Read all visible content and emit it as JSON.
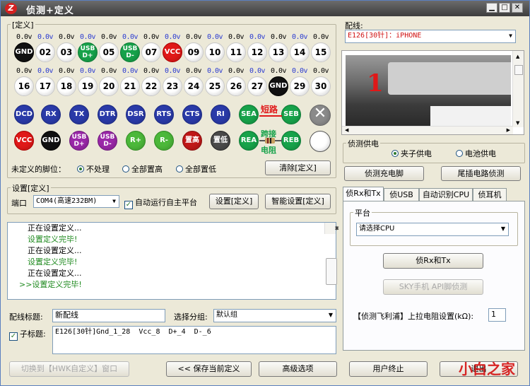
{
  "window": {
    "title": "侦测+定义",
    "app_icon": "Z",
    "controls": [
      "▁",
      "□",
      "✕"
    ]
  },
  "define_group": {
    "title": "[定义]"
  },
  "row1_voltages": [
    "0.0v",
    "0.0v",
    "0.0v",
    "0.0v",
    "0.0v",
    "0.0v",
    "0.0v",
    "0.0v",
    "0.0v",
    "0.0v",
    "0.0v",
    "0.0v",
    "0.0v",
    "0.0v",
    "0.0v",
    "0.0v",
    "0.0v",
    "0.0v",
    "0.0v",
    "0.0v",
    "0.0v",
    "0.0v",
    "0.0v",
    "0.0v",
    "0.0v",
    "0.0v",
    "0.0v",
    "0.0v",
    "0.0v",
    "0.0v"
  ],
  "row1_pins": [
    {
      "label": "GND",
      "style": "black"
    },
    {
      "label": "02",
      "style": "white"
    },
    {
      "label": "03",
      "style": "white"
    },
    {
      "label": "USB D+",
      "style": "green"
    },
    {
      "label": "05",
      "style": "white"
    },
    {
      "label": "USB D-",
      "style": "green"
    },
    {
      "label": "07",
      "style": "white"
    },
    {
      "label": "VCC",
      "style": "red"
    },
    {
      "label": "09",
      "style": "white"
    },
    {
      "label": "10",
      "style": "white"
    },
    {
      "label": "11",
      "style": "white"
    },
    {
      "label": "12",
      "style": "white"
    },
    {
      "label": "13",
      "style": "white"
    },
    {
      "label": "14",
      "style": "white"
    },
    {
      "label": "15",
      "style": "white"
    }
  ],
  "row2_pins": [
    {
      "label": "16",
      "style": "white"
    },
    {
      "label": "17",
      "style": "white"
    },
    {
      "label": "18",
      "style": "white"
    },
    {
      "label": "19",
      "style": "white"
    },
    {
      "label": "20",
      "style": "white"
    },
    {
      "label": "21",
      "style": "white"
    },
    {
      "label": "22",
      "style": "white"
    },
    {
      "label": "23",
      "style": "white"
    },
    {
      "label": "24",
      "style": "white"
    },
    {
      "label": "25",
      "style": "white"
    },
    {
      "label": "26",
      "style": "white"
    },
    {
      "label": "27",
      "style": "white"
    },
    {
      "label": "GND",
      "style": "black"
    },
    {
      "label": "29",
      "style": "white"
    },
    {
      "label": "30",
      "style": "white"
    }
  ],
  "signal_row": [
    "DCD",
    "RX",
    "TX",
    "DTR",
    "DSR",
    "RTS",
    "CTS",
    "RI",
    "SEA",
    "SEB"
  ],
  "short_label": "短路",
  "close_icon": "✕",
  "power_row": [
    {
      "label": "VCC",
      "style": "red"
    },
    {
      "label": "GND",
      "style": "black"
    },
    {
      "label": "USB D+",
      "style": "purple"
    },
    {
      "label": "USB D-",
      "style": "purple"
    },
    {
      "label": "R+",
      "style": "lgreen"
    },
    {
      "label": "R-",
      "style": "lgreen"
    },
    {
      "label": "置高",
      "style": "dred"
    },
    {
      "label": "置低",
      "style": "dgray"
    },
    {
      "label": "REA",
      "style": "green"
    },
    {
      "label": "REB",
      "style": "green"
    }
  ],
  "resistor_label_1": "跨接",
  "resistor_label_2": "电阻",
  "undefined_pins": {
    "label": "未定义的脚位：",
    "options": [
      "不处理",
      "全部置高",
      "全部置低"
    ],
    "selected": 0,
    "clear_button": "清除[定义]"
  },
  "settings_group": {
    "title": "设置[定义]",
    "port_label": "端口",
    "port_value": "COM4(高速232BM)",
    "auto_run_label": "自动运行自主平台",
    "auto_run_checked": true,
    "set_button": "设置[定义]",
    "smart_button": "智能设置[定义]"
  },
  "log_lines": [
    {
      "text": "正在设置定义...",
      "color": "black"
    },
    {
      "text": "设置定义完毕!",
      "color": "green"
    },
    {
      "text": "正在设置定义...",
      "color": "black"
    },
    {
      "text": "设置定义完毕!",
      "color": "green"
    },
    {
      "text": "正在设置定义...",
      "color": "black"
    },
    {
      "text": ">>设置定义完毕!",
      "color": "green"
    }
  ],
  "wiring": {
    "title_label": "配线标题:",
    "title_value": "新配线",
    "group_label": "选择分组:",
    "group_value": "默认组",
    "subtitle_label": "子标题:",
    "subtitle_checked": true,
    "subtitle_value": "E126[30针]Gnd_1_28  Vcc_8  D+_4  D-_6"
  },
  "bottom_buttons": {
    "switch": "切换到【HWK自定义】窗口",
    "save": "<< 保存当前定义",
    "advanced": "高级选项",
    "user_stop": "用户终止",
    "exit": "退出"
  },
  "right": {
    "wiring_label": "配线:",
    "wiring_value": "E126[30针]：iPHONE",
    "photo_number": "1",
    "power_group": "侦测供电",
    "power_options": [
      "夹子供电",
      "电池供电"
    ],
    "power_selected": 0,
    "charge_button": "侦测充电脚",
    "tail_button": "尾插电路侦测",
    "tabs": [
      "侦Rx和Tx",
      "侦USB",
      "自动识别CPU",
      "侦耳机"
    ],
    "active_tab": 0,
    "platform_label": "平台",
    "platform_value": "请选择CPU",
    "detect_button": "侦Rx和Tx",
    "sky_button": "SKY手机 API脚侦测",
    "pullup_label": "【侦测飞利浦】上拉电阻设置(kΩ):",
    "pullup_value": "1"
  },
  "watermark": "小白之家",
  "colors": {
    "accent": "#2a3aa8",
    "gnd": "#111111",
    "vcc": "#e01818",
    "usb": "#17a24a",
    "short": "#e01818",
    "window_bg": "#ece9d8"
  }
}
